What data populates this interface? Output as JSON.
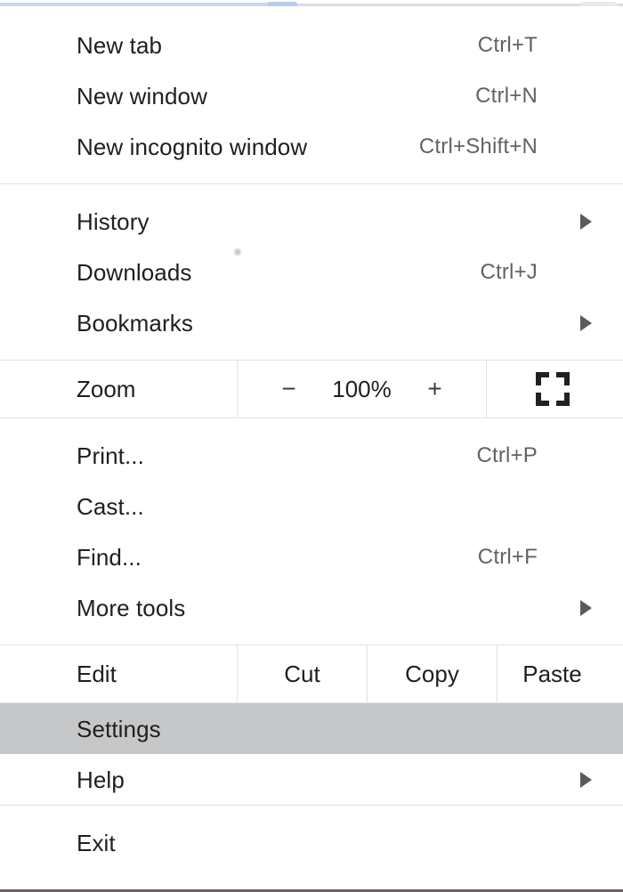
{
  "window": {
    "title": "Chrome Browser Menu",
    "accent_color": "#c9d8ee",
    "highlight_color": "#c6c7c9",
    "separator_color": "#e3e3e3",
    "text_color": "#1f1f1f",
    "shortcut_color": "#5f6368",
    "bottom_border_color": "#6e5f68"
  },
  "menu": {
    "groups": [
      {
        "name": "new-group",
        "items": [
          {
            "label": "New tab",
            "shortcut": "Ctrl+T",
            "submenu": false
          },
          {
            "label": "New window",
            "shortcut": "Ctrl+N",
            "submenu": false
          },
          {
            "label": "New incognito window",
            "shortcut": "Ctrl+Shift+N",
            "submenu": false
          }
        ]
      },
      {
        "name": "browsing-group",
        "items": [
          {
            "label": "History",
            "shortcut": "",
            "submenu": true
          },
          {
            "label": "Downloads",
            "shortcut": "Ctrl+J",
            "submenu": false
          },
          {
            "label": "Bookmarks",
            "shortcut": "",
            "submenu": true
          }
        ]
      },
      {
        "name": "zoom-group",
        "zoom": {
          "label": "Zoom",
          "decrease_label": "−",
          "value": "100%",
          "increase_label": "+",
          "fullscreen_icon": "fullscreen-icon"
        }
      },
      {
        "name": "tools-group",
        "items": [
          {
            "label": "Print...",
            "shortcut": "Ctrl+P",
            "submenu": false
          },
          {
            "label": "Cast...",
            "shortcut": "",
            "submenu": false
          },
          {
            "label": "Find...",
            "shortcut": "Ctrl+F",
            "submenu": false
          },
          {
            "label": "More tools",
            "shortcut": "",
            "submenu": true
          }
        ]
      },
      {
        "name": "edit-group",
        "edit": {
          "label": "Edit",
          "cut_label": "Cut",
          "copy_label": "Copy",
          "paste_label": "Paste"
        }
      },
      {
        "name": "settings-group",
        "items": [
          {
            "label": "Settings",
            "shortcut": "",
            "submenu": false,
            "highlighted": true
          },
          {
            "label": "Help",
            "shortcut": "",
            "submenu": true,
            "highlighted": false
          }
        ]
      },
      {
        "name": "exit-group",
        "items": [
          {
            "label": "Exit",
            "shortcut": "",
            "submenu": false
          }
        ]
      }
    ]
  }
}
